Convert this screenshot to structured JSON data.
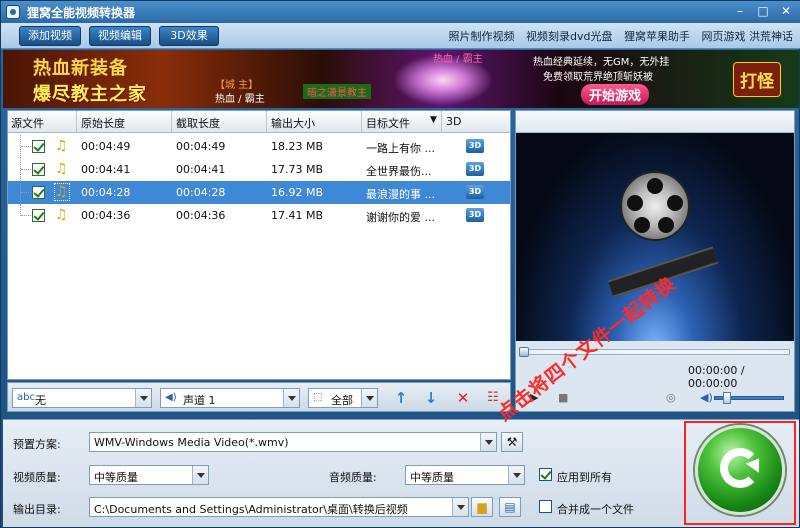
{
  "window": {
    "title": "狸窝全能视频转换器"
  },
  "menubar": {
    "buttons": [
      "添加视频",
      "视频编辑",
      "3D效果"
    ],
    "links": [
      "照片制作视频",
      "视频刻录dvd光盘",
      "狸窝苹果助手",
      "网页游戏 洪荒神话"
    ]
  },
  "banner": {
    "line1": "热血新装备",
    "line2": "爆尽教主之家",
    "tag1": "【城 主】",
    "tag2": "热血 / 霸主",
    "tag3": "暗之潇景教主",
    "tag4": "热血 / 霸主",
    "promo1": "热血经典延续，无GM，无外挂",
    "promo2": "免费领取荒界绝顶斩妖被",
    "start": "开始游戏",
    "slogan": "打怪"
  },
  "file_list": {
    "columns": [
      "源文件",
      "原始长度",
      "截取长度",
      "输出大小",
      "目标文件",
      "3D"
    ],
    "rows": [
      {
        "orig": "00:04:49",
        "cut": "00:04:49",
        "size": "18.23 MB",
        "target": "一路上有你 ..."
      },
      {
        "orig": "00:04:41",
        "cut": "00:04:41",
        "size": "17.73 MB",
        "target": "全世界最伤..."
      },
      {
        "orig": "00:04:28",
        "cut": "00:04:28",
        "size": "16.92 MB",
        "target": "最浪漫的事 ..."
      },
      {
        "orig": "00:04:36",
        "cut": "00:04:36",
        "size": "17.41 MB",
        "target": "谢谢你的爱 ..."
      }
    ],
    "selected_row": 2
  },
  "list_toolbar": {
    "subtitle": "无",
    "audio_track": "声道 1",
    "scope": "全部"
  },
  "preview": {
    "time": "00:00:00 / 00:00:00"
  },
  "settings": {
    "preset_label": "预置方案:",
    "preset_value": "WMV-Windows Media Video(*.wmv)",
    "video_quality_label": "视频质量:",
    "video_quality_value": "中等质量",
    "audio_quality_label": "音频质量:",
    "audio_quality_value": "中等质量",
    "apply_all": "应用到所有",
    "output_label": "输出目录:",
    "output_value": "C:\\Documents and Settings\\Administrator\\桌面\\转换后视频",
    "merge": "合并成一个文件"
  },
  "hint_text": "点击将四个文件一起转换",
  "colors": {
    "selection": "#3f88d6",
    "hint": "#ff2a2a",
    "convert": "#1f8f1f"
  }
}
